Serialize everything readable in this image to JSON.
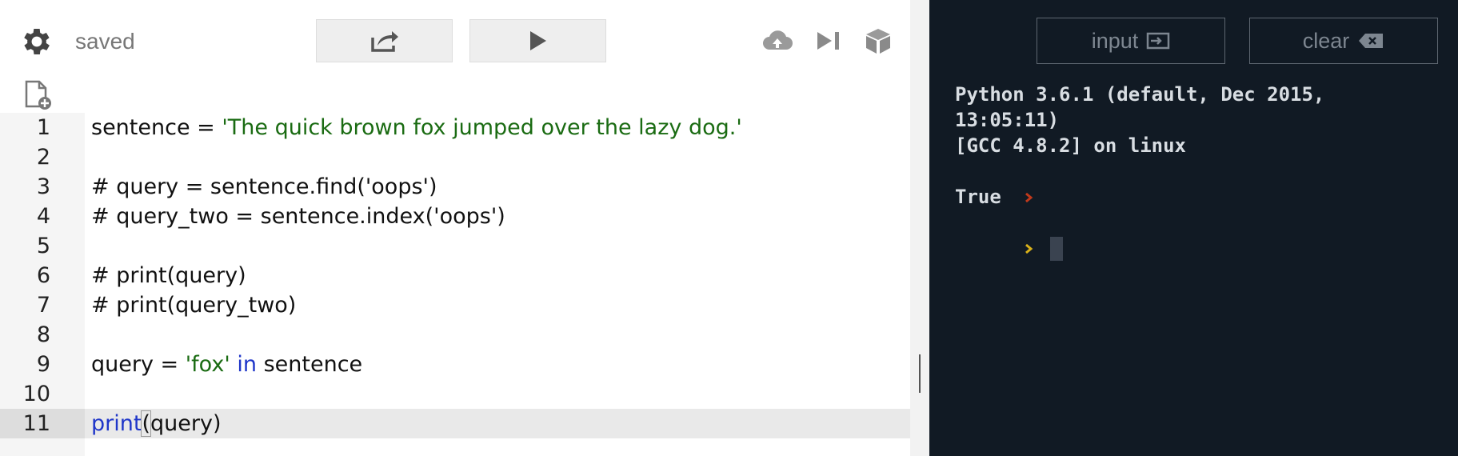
{
  "toolbar": {
    "status": "saved",
    "share_icon": "share-icon",
    "run_icon": "play-icon",
    "icons": [
      "settings-gear-icon",
      "cloud-upload-icon",
      "step-icon",
      "package-icon",
      "new-file-icon"
    ]
  },
  "editor": {
    "lines": [
      {
        "num": "1",
        "code": ""
      },
      {
        "num": "2",
        "code": ""
      },
      {
        "num": "3",
        "code": "# query = sentence.find('oops')"
      },
      {
        "num": "4",
        "code": "# query_two = sentence.index('oops')"
      },
      {
        "num": "5",
        "code": ""
      },
      {
        "num": "6",
        "code": "# print(query)"
      },
      {
        "num": "7",
        "code": "# print(query_two)"
      },
      {
        "num": "8",
        "code": ""
      },
      {
        "num": "9",
        "code": ""
      },
      {
        "num": "10",
        "code": ""
      },
      {
        "num": "11",
        "code": ""
      }
    ],
    "line1": {
      "var": "sentence",
      "op": " = ",
      "str": "'The quick brown fox jumped over the lazy dog.'"
    },
    "line9": {
      "var": "query",
      "op": " = ",
      "str": "'fox'",
      "kw": "in",
      "rest": "sentence"
    },
    "line11": {
      "kw": "print",
      "open": "(",
      "arg": "query",
      "close": ")"
    }
  },
  "console": {
    "input_label": "input",
    "clear_label": "clear",
    "output": [
      "Python 3.6.1 (default, Dec 2015,",
      "13:05:11)",
      "[GCC 4.8.2] on linux",
      "",
      "True"
    ]
  },
  "colors": {
    "string": "#1a6b12",
    "comment": "#3e7c4a",
    "keyword": "#1f36c9",
    "console_bg": "#111a24",
    "prompt_red": "#c0391b",
    "prompt_yellow": "#d9b11a"
  }
}
